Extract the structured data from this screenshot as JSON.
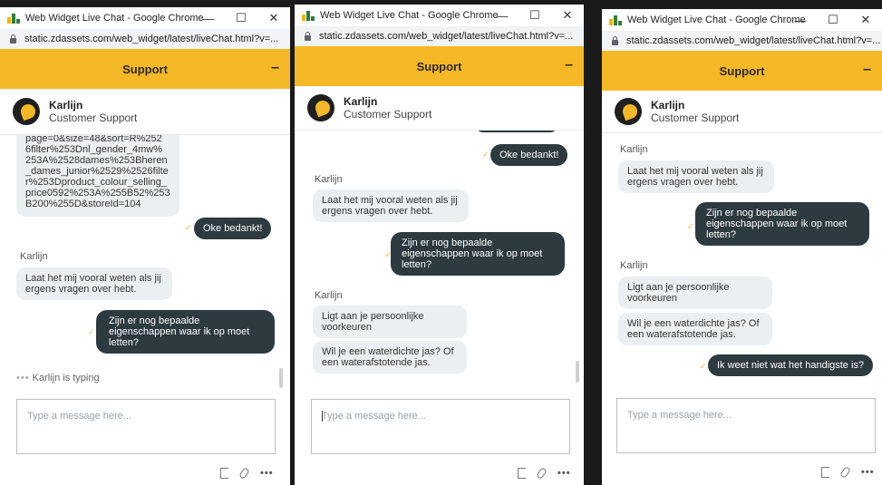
{
  "windows": [
    {
      "title": "Web Widget Live Chat - Google Chrome",
      "url": "static.zdassets.com/web_widget/latest/liveChat.html?v=...",
      "widget_title": "Support",
      "agent_name": "Karlijn",
      "agent_role": "Customer Support",
      "messages": {
        "m1": "page=0&size=48&sort=R%252\n6filter%253Dnl_gender_4mw%\n253A%2528dames%253Bheren\n_dames_junior%2529%2526filte\nr%253Dproduct_colour_selling_\nprice0592%253A%255B52%253\nB200%255D&storeId=104",
        "m2": "Oke bedankt!",
        "m3_sender": "Karlijn",
        "m3": "Laat het mij vooral weten als jij\nergens vragen over hebt.",
        "m4": "Zijn er nog bepaalde\neigenschappen waar ik op moet\nletten?",
        "typing": "Karlijn is typing"
      },
      "input_placeholder": "Type a message here..."
    },
    {
      "title": "Web Widget Live Chat - Google Chrome",
      "url": "static.zdassets.com/web_widget/latest/liveChat.html?v=...",
      "widget_title": "Support",
      "agent_name": "Karlijn",
      "agent_role": "Customer Support",
      "messages": {
        "m1": "Oke bedankt!",
        "s1": "Karlijn",
        "m2": "Laat het mij vooral weten als jij\nergens vragen over hebt.",
        "m3": "Zijn er nog bepaalde\neigenschappen waar ik op moet\nletten?",
        "s2": "Karlijn",
        "m4": "Ligt aan je persoonlijke\nvoorkeuren",
        "m5": "Wil je een waterdichte jas? Of\neen waterafstotende jas."
      },
      "input_placeholder": "Type a message here..."
    },
    {
      "title": "Web Widget Live Chat - Google Chrome",
      "url": "static.zdassets.com/web_widget/latest/liveChat.html?v=...",
      "widget_title": "Support",
      "agent_name": "Karlijn",
      "agent_role": "Customer Support",
      "messages": {
        "s1": "Karlijn",
        "m1": "Laat het mij vooral weten als jij\nergens vragen over hebt.",
        "m2": "Zijn er nog bepaalde\neigenschappen waar ik op moet\nletten?",
        "s2": "Karlijn",
        "m3": "Ligt aan je persoonlijke\nvoorkeuren",
        "m4": "Wil je een waterdichte jas? Of\neen waterafstotende jas.",
        "m5": "Ik weet niet wat het handigste is?"
      },
      "input_placeholder": "Type a message here..."
    }
  ],
  "colors": {
    "accent": "#f5b826",
    "out_bubble": "#2d3a40",
    "in_bubble": "#eceff1"
  }
}
